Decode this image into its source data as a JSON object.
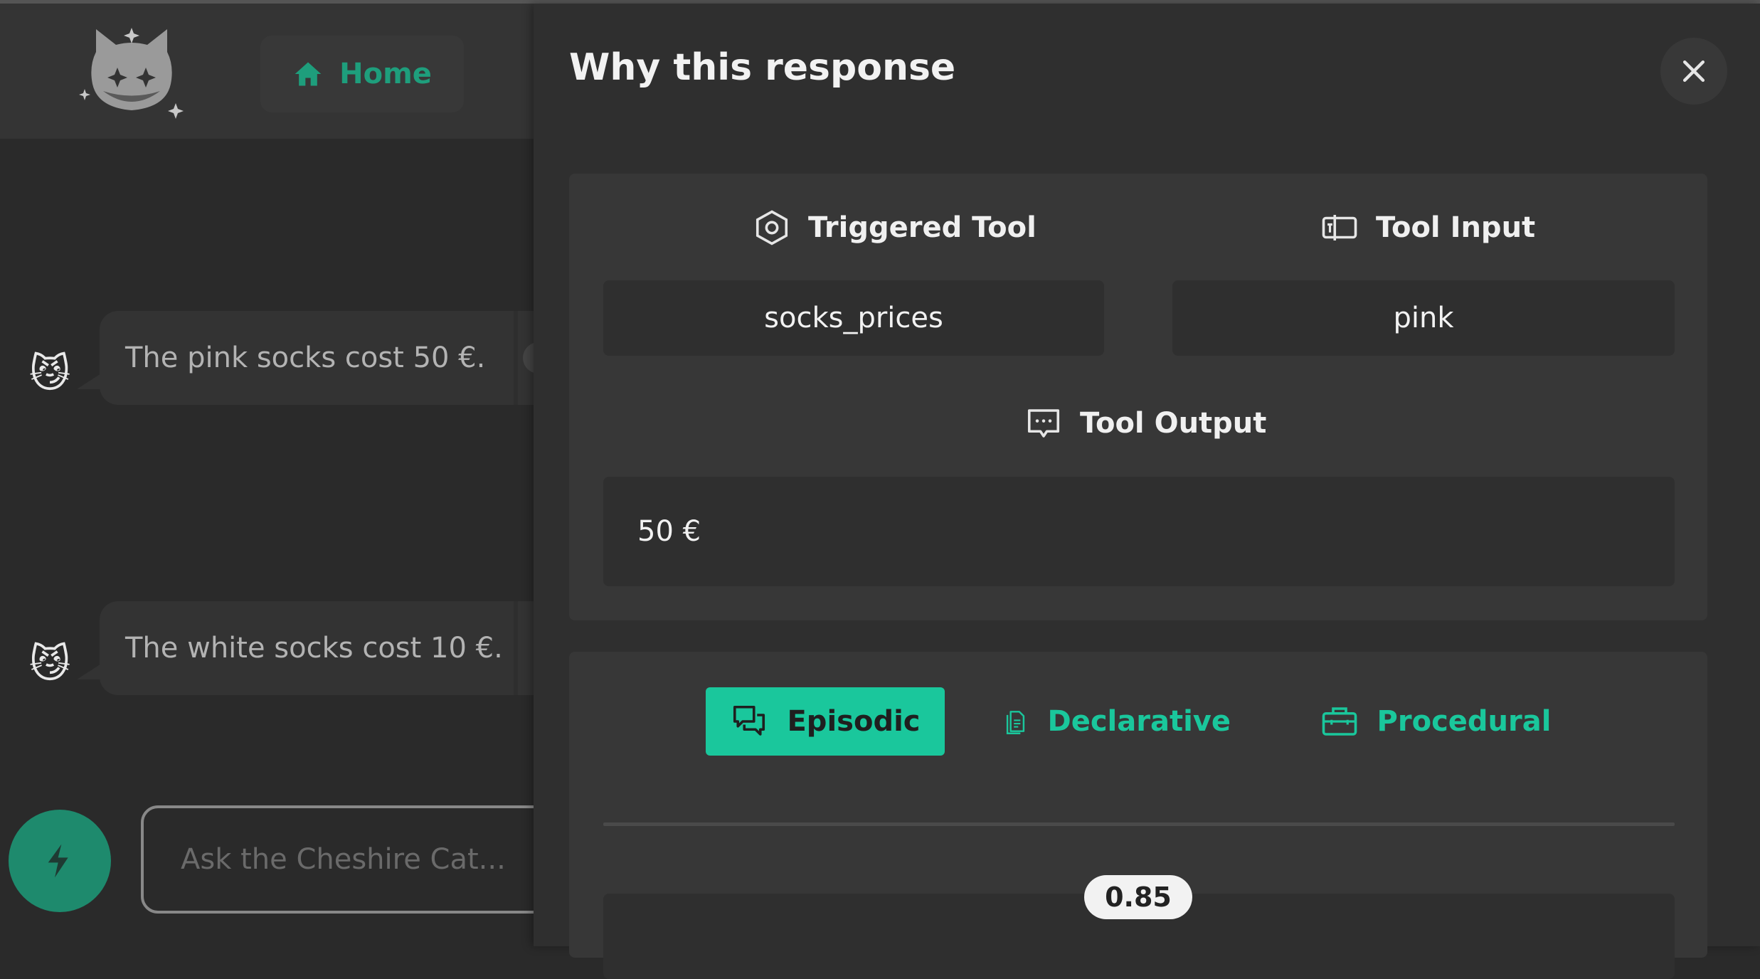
{
  "app": {
    "home_label": "Home",
    "messages": [
      {
        "avatar": "😼",
        "text": "The pink socks cost 50 €."
      },
      {
        "avatar": "😼",
        "text": "The white socks cost 10 €."
      }
    ],
    "input_placeholder": "Ask the Cheshire Cat..."
  },
  "panel": {
    "title": "Why this response",
    "triggered_tool_label": "Triggered Tool",
    "triggered_tool_value": "socks_prices",
    "tool_input_label": "Tool Input",
    "tool_input_value": "pink",
    "tool_output_label": "Tool Output",
    "tool_output_value": "50 €",
    "memory_tabs": [
      {
        "label": "Episodic",
        "active": true
      },
      {
        "label": "Declarative",
        "active": false
      },
      {
        "label": "Procedural",
        "active": false
      }
    ],
    "memory_score": "0.85"
  },
  "colors": {
    "accent": "#1ac79c",
    "accent_dark": "#1e8a6d",
    "panel_bg": "#2f2f2f",
    "card_bg": "#373737"
  },
  "icons": {
    "home": "home-icon",
    "close": "close-icon",
    "triggered_tool": "hexagon-icon",
    "tool_input": "input-icon",
    "tool_output": "message-dots-icon",
    "episodic": "chat-bubbles-icon",
    "declarative": "document-icon",
    "procedural": "briefcase-icon",
    "send": "bolt-icon"
  }
}
